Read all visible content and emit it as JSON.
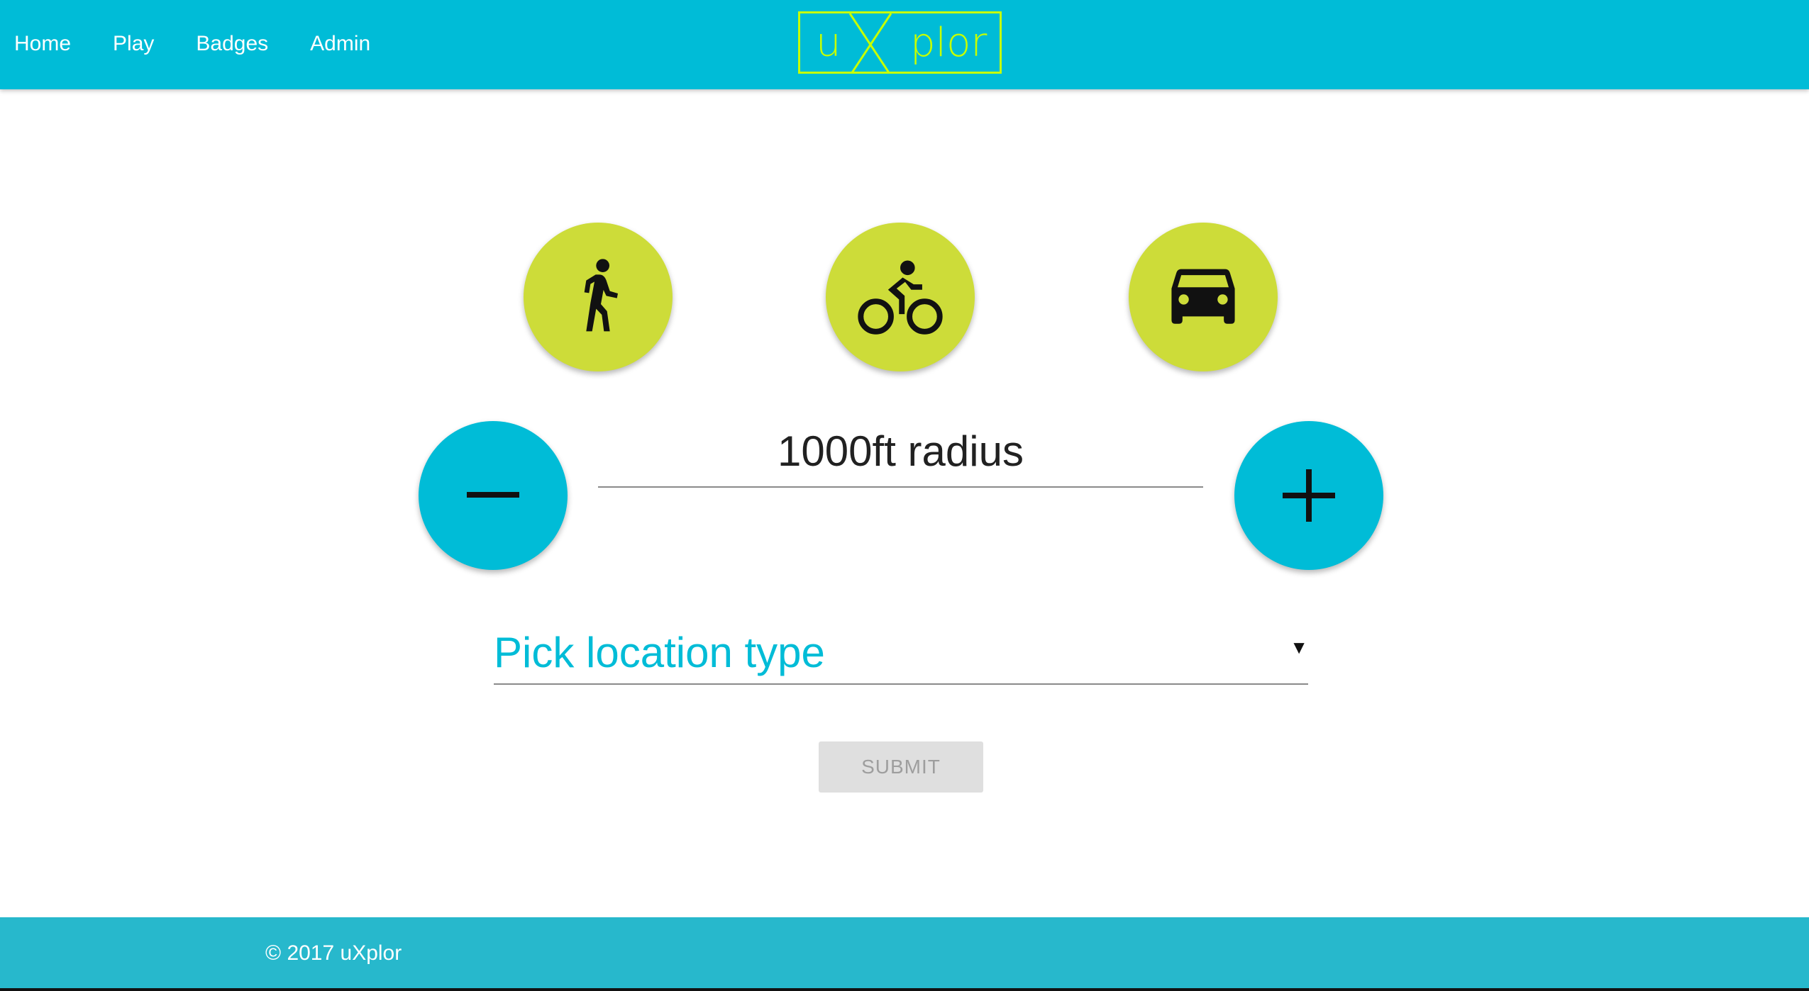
{
  "nav": {
    "links": [
      "Home",
      "Play",
      "Badges",
      "Admin"
    ]
  },
  "logo": {
    "prefix": "u",
    "mark": "X",
    "suffix": "plor",
    "color": "#c6ff00"
  },
  "modes": [
    {
      "icon": "walk-icon",
      "label": "Walk"
    },
    {
      "icon": "bike-icon",
      "label": "Bike"
    },
    {
      "icon": "car-icon",
      "label": "Car"
    }
  ],
  "radius": {
    "value_text": "1000ft radius",
    "decrease_icon": "minus-icon",
    "increase_icon": "plus-icon"
  },
  "location_select": {
    "placeholder": "Pick location type",
    "arrow": "▼"
  },
  "submit": {
    "label": "SUBMIT"
  },
  "footer": {
    "text": "© 2017 uXplor"
  },
  "colors": {
    "primary": "#00bcd7",
    "accent": "#cddc39",
    "footer": "#27b8cc"
  }
}
